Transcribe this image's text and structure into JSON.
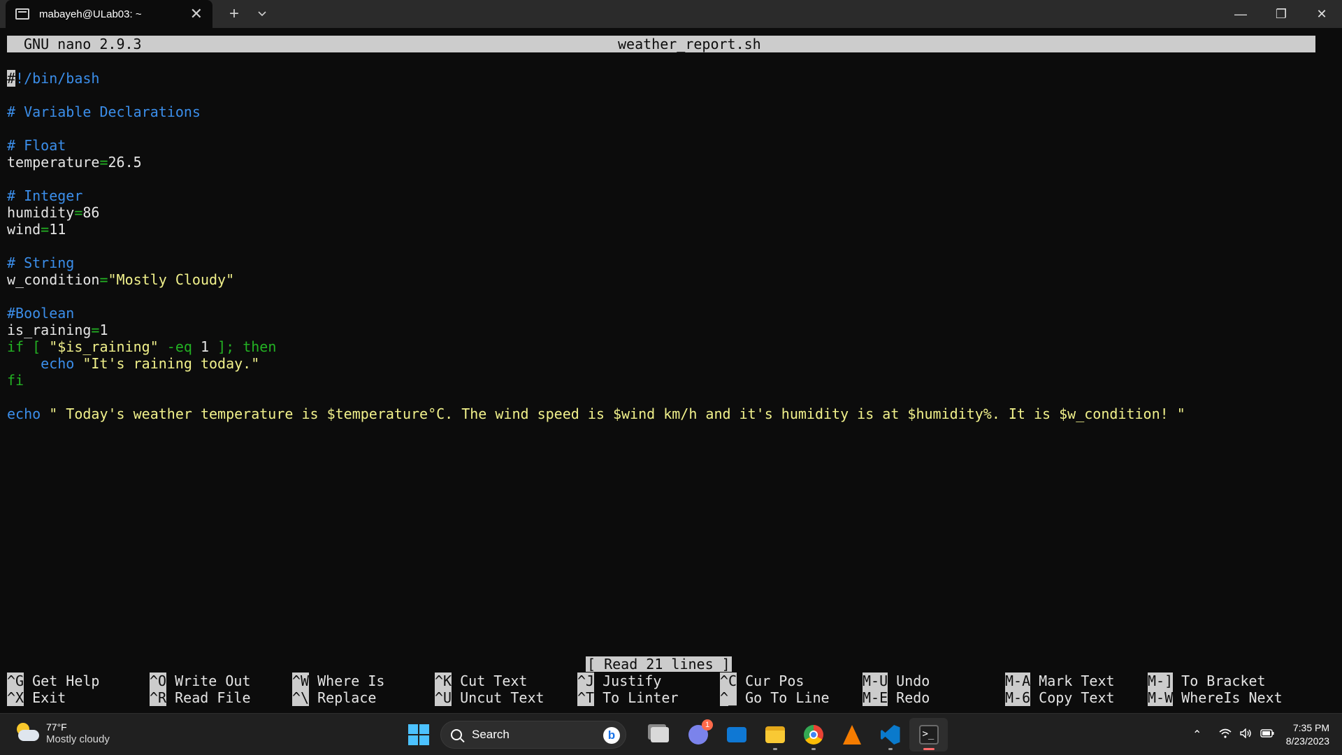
{
  "window": {
    "tab_title": "mabayeh@ULab03: ~",
    "new_tab": "+",
    "close_glyph": "✕",
    "minimize_glyph": "—",
    "restore_glyph": "❐"
  },
  "nano": {
    "version": "GNU nano 2.9.3",
    "filename": "weather_report.sh",
    "status": "[ Read 21 lines ]"
  },
  "code": {
    "l1": "#!/bin/bash",
    "l3": "# Variable Declarations",
    "l5": "# Float",
    "l6_var": "temperature",
    "l6_val": "26.5",
    "l8": "# Integer",
    "l9_var": "humidity",
    "l9_val": "86",
    "l10_var": "wind",
    "l10_val": "11",
    "l12": "# String",
    "l13_var": "w_condition",
    "l13_val": "\"Mostly Cloudy\"",
    "l15": "#Boolean",
    "l16_var": "is_raining",
    "l16_val": "1",
    "l17_if": "if [ ",
    "l17_str": "\"$is_raining\"",
    "l17_op": " -eq ",
    "l17_num": "1",
    "l17_end": " ]; then",
    "l18_cmd": "echo",
    "l18_str": "\"It's raining today.\"",
    "l19": "fi",
    "l21_cmd": "echo",
    "l21_str": "\" Today's weather temperature is $temperature°C. The wind speed is $wind km/h and it's humidity is at $humidity%. It is $w_condition! \""
  },
  "shortcuts": [
    {
      "key": "^G",
      "label": "Get Help"
    },
    {
      "key": "^X",
      "label": "Exit"
    },
    {
      "key": "^O",
      "label": "Write Out"
    },
    {
      "key": "^R",
      "label": "Read File"
    },
    {
      "key": "^W",
      "label": "Where Is"
    },
    {
      "key": "^\\",
      "label": "Replace"
    },
    {
      "key": "^K",
      "label": "Cut Text"
    },
    {
      "key": "^U",
      "label": "Uncut Text"
    },
    {
      "key": "^J",
      "label": "Justify"
    },
    {
      "key": "^T",
      "label": "To Linter"
    },
    {
      "key": "^C",
      "label": "Cur Pos"
    },
    {
      "key": "^_",
      "label": "Go To Line"
    },
    {
      "key": "M-U",
      "label": "Undo"
    },
    {
      "key": "M-E",
      "label": "Redo"
    },
    {
      "key": "M-A",
      "label": "Mark Text"
    },
    {
      "key": "M-6",
      "label": "Copy Text"
    },
    {
      "key": "M-]",
      "label": "To Bracket"
    },
    {
      "key": "M-W",
      "label": "WhereIs Next"
    }
  ],
  "taskbar": {
    "weather_temp": "77°F",
    "weather_cond": "Mostly cloudy",
    "search_placeholder": "Search",
    "bing_letter": "b",
    "chat_badge": "1",
    "time": "7:35 PM",
    "date": "8/23/2023",
    "icons": [
      "windows-start-icon",
      "file-explorer-icon",
      "teams-chat-icon",
      "mail-icon",
      "folder-icon",
      "chrome-icon",
      "vlc-icon",
      "vscode-icon",
      "terminal-icon"
    ],
    "colors": {
      "accent": "#4cc2ff",
      "active_indicator": "#ff6a6a"
    }
  },
  "colors": {
    "comment": "#3b8eea",
    "keyword": "#23b223",
    "string": "#f1f18b",
    "text": "#e5e5e5",
    "bar": "#cccccc"
  }
}
